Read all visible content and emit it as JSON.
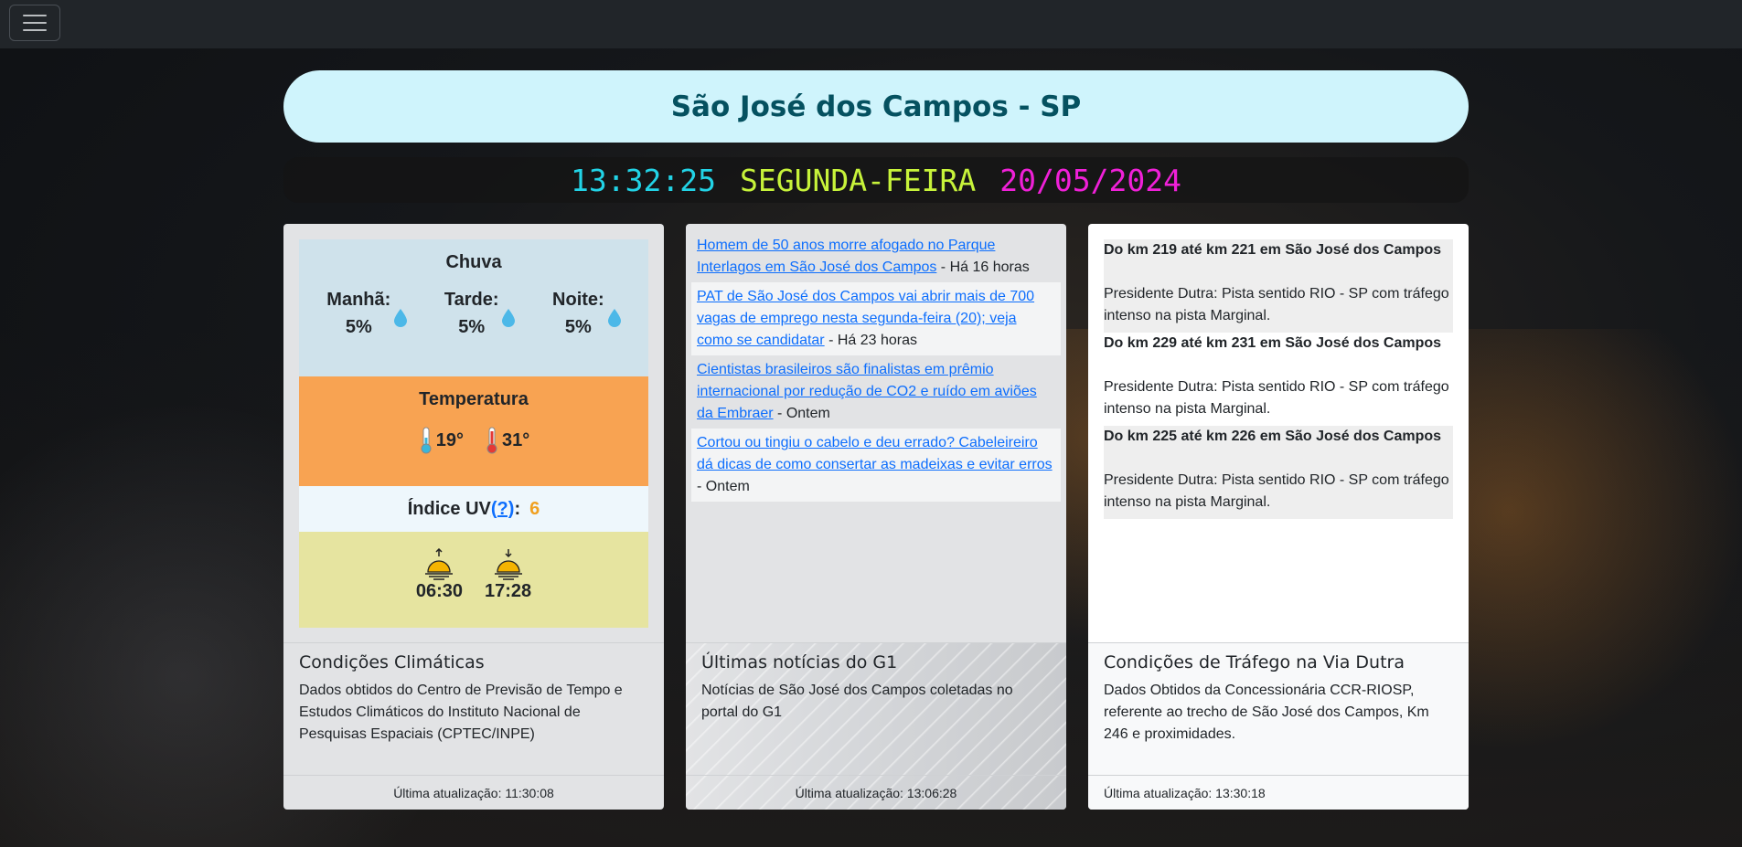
{
  "navbar": {
    "menu_icon": "hamburger-menu-icon"
  },
  "city": "São José dos Campos - SP",
  "clock": {
    "time": "13:32:25",
    "day": "SEGUNDA-FEIRA",
    "date": "20/05/2024"
  },
  "weather": {
    "rain": {
      "title": "Chuva",
      "items": [
        {
          "label": "Manhã:",
          "value": "5%"
        },
        {
          "label": "Tarde:",
          "value": "5%"
        },
        {
          "label": "Noite:",
          "value": "5%"
        }
      ]
    },
    "temperature": {
      "title": "Temperatura",
      "min": "19°",
      "max": "31°"
    },
    "uv": {
      "label": "Índice UV",
      "help": "(?)",
      "colon": ":",
      "value": "6"
    },
    "sun": {
      "sunrise": "06:30",
      "sunset": "17:28"
    },
    "card_title": "Condições Climáticas",
    "card_text": "Dados obtidos do Centro de Previsão de Tempo e Estudos Climáticos do Instituto Nacional de Pesquisas Espaciais (CPTEC/INPE)",
    "footer": "Última atualização: 11:30:08"
  },
  "news": {
    "items": [
      {
        "title": "Homem de 50 anos morre afogado no Parque Interlagos em São José dos Campos",
        "when": " - Há 16 horas"
      },
      {
        "title": "PAT de São José dos Campos vai abrir mais de 700 vagas de emprego nesta segunda-feira (20); veja como se candidatar",
        "when": " - Há 23 horas"
      },
      {
        "title": "Cientistas brasileiros são finalistas em prêmio internacional por redução de CO2 e ruído em aviões da Embraer",
        "when": " - Ontem"
      },
      {
        "title": "Cortou ou tingiu o cabelo e deu errado? Cabeleireiro dá dicas de como consertar as madeixas e evitar erros",
        "when": " - Ontem"
      }
    ],
    "card_title": "Últimas notícias do G1",
    "card_text": "Notícias de São José dos Campos coletadas no portal do G1",
    "footer": "Última atualização: 13:06:28"
  },
  "traffic": {
    "items": [
      {
        "location": "Do km 219 até km 221 em São José dos Campos",
        "description": "Presidente Dutra: Pista sentido RIO - SP com tráfego intenso na pista Marginal."
      },
      {
        "location": "Do km 229 até km 231 em São José dos Campos",
        "description": "Presidente Dutra: Pista sentido RIO - SP com tráfego intenso na pista Marginal."
      },
      {
        "location": "Do km 225 até km 226 em São José dos Campos",
        "description": "Presidente Dutra: Pista sentido RIO - SP com tráfego intenso na pista Marginal."
      }
    ],
    "card_title": "Condições de Tráfego na Via Dutra",
    "card_text": "Dados Obtidos da Concessionária CCR-RIOSP, referente ao trecho de São José dos Campos, Km 246 e proximidades.",
    "footer": "Última atualização: 13:30:18"
  }
}
